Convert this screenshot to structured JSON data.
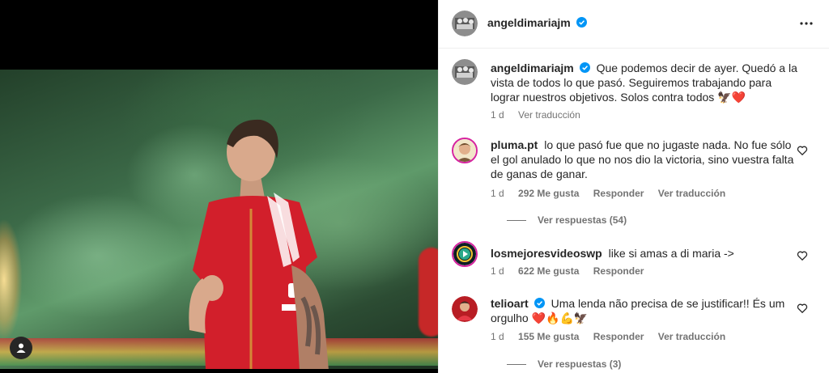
{
  "post": {
    "author": "angeldimariajm",
    "more_icon": "more-horizontal-icon"
  },
  "caption": {
    "author": "angeldimariajm",
    "text": "Que podemos decir de ayer. Quedó a la vista de todos lo que pasó. Seguiremos trabajando para lograr nuestros objetivos. Solos contra todos",
    "emojis": "🦅❤️",
    "time": "1 d",
    "translate": "Ver traducción"
  },
  "comments": [
    {
      "author": "pluma.pt",
      "text": "lo que pasó fue que no jugaste nada. No fue sólo el gol anulado lo que no nos dio la victoria, sino vuestra falta de ganas de ganar.",
      "time": "1 d",
      "likes": "292 Me gusta",
      "reply": "Responder",
      "translate": "Ver traducción",
      "view_replies": "Ver respuestas (54)"
    },
    {
      "author": "losmejoresvideoswp",
      "text": "like si amas a di maria ->",
      "time": "1 d",
      "likes": "622 Me gusta",
      "reply": "Responder"
    },
    {
      "author": "telioart",
      "text": "Uma lenda não precisa de se justificar!! És um orgulho",
      "emojis": "❤️🔥💪🦅",
      "time": "1 d",
      "likes": "155 Me gusta",
      "reply": "Responder",
      "translate": "Ver traducción",
      "view_replies": "Ver respuestas (3)"
    }
  ],
  "colors": {
    "verified": "#0095f6",
    "muted": "#737373",
    "text": "#262626",
    "story_ring": "#d6249f"
  }
}
